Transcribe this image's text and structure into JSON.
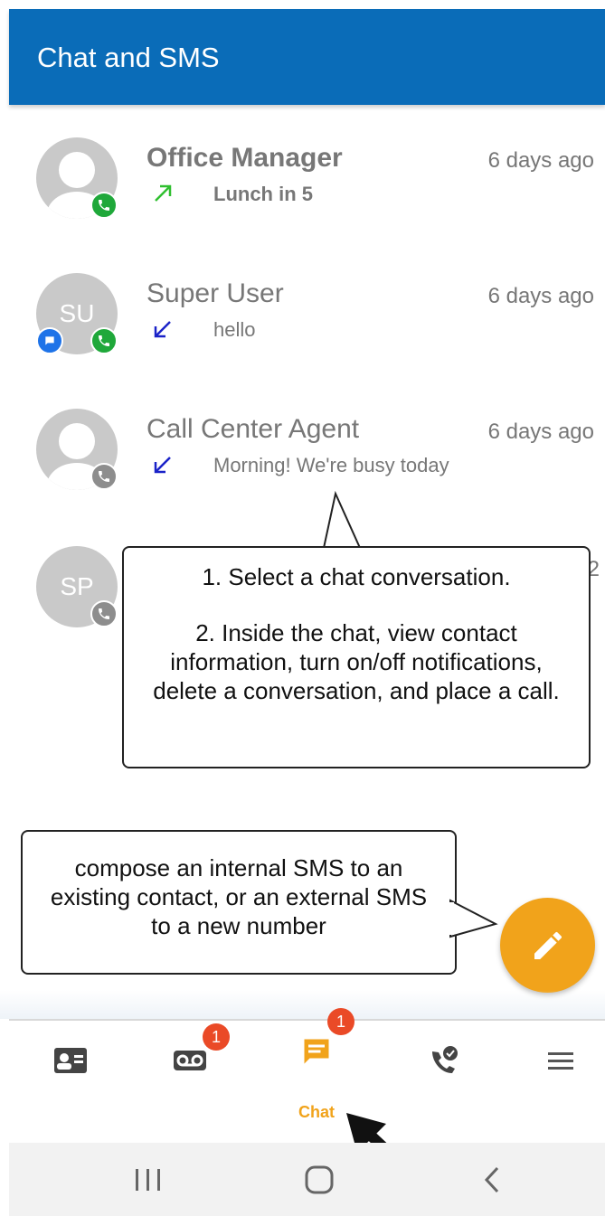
{
  "appbar": {
    "title": "Chat and SMS"
  },
  "conversations": [
    {
      "name": "Office Manager",
      "time": "6 days ago",
      "preview": "Lunch in 5",
      "direction": "outgoing",
      "avatar_initials": "",
      "bold": true
    },
    {
      "name": "Super User",
      "time": "6 days ago",
      "preview": "hello",
      "direction": "incoming",
      "avatar_initials": "SU",
      "bold": false
    },
    {
      "name": "Call Center Agent",
      "time": "6 days ago",
      "preview": "Morning! We're busy today",
      "direction": "incoming",
      "avatar_initials": "",
      "bold": false
    },
    {
      "name": "",
      "time": "2",
      "preview": "",
      "direction": "",
      "avatar_initials": "SP",
      "bold": false
    }
  ],
  "callouts": {
    "select_line1": "1. Select a chat conversation.",
    "select_line2": "2. Inside the chat, view contact information, turn on/off notifications, delete a conversation, and place a call.",
    "compose": "compose an internal SMS to an existing contact, or an external SMS to a new number"
  },
  "nav": {
    "voicemail_badge": "1",
    "chat_badge": "1",
    "chat_label": "Chat"
  },
  "colors": {
    "appbar": "#0a6cb8",
    "accent": "#f1a31b",
    "badge": "#ea4a27",
    "call_green": "#1fa83a",
    "outgoing_arrow": "#2fbf2f",
    "incoming_arrow": "#1a22c8"
  }
}
